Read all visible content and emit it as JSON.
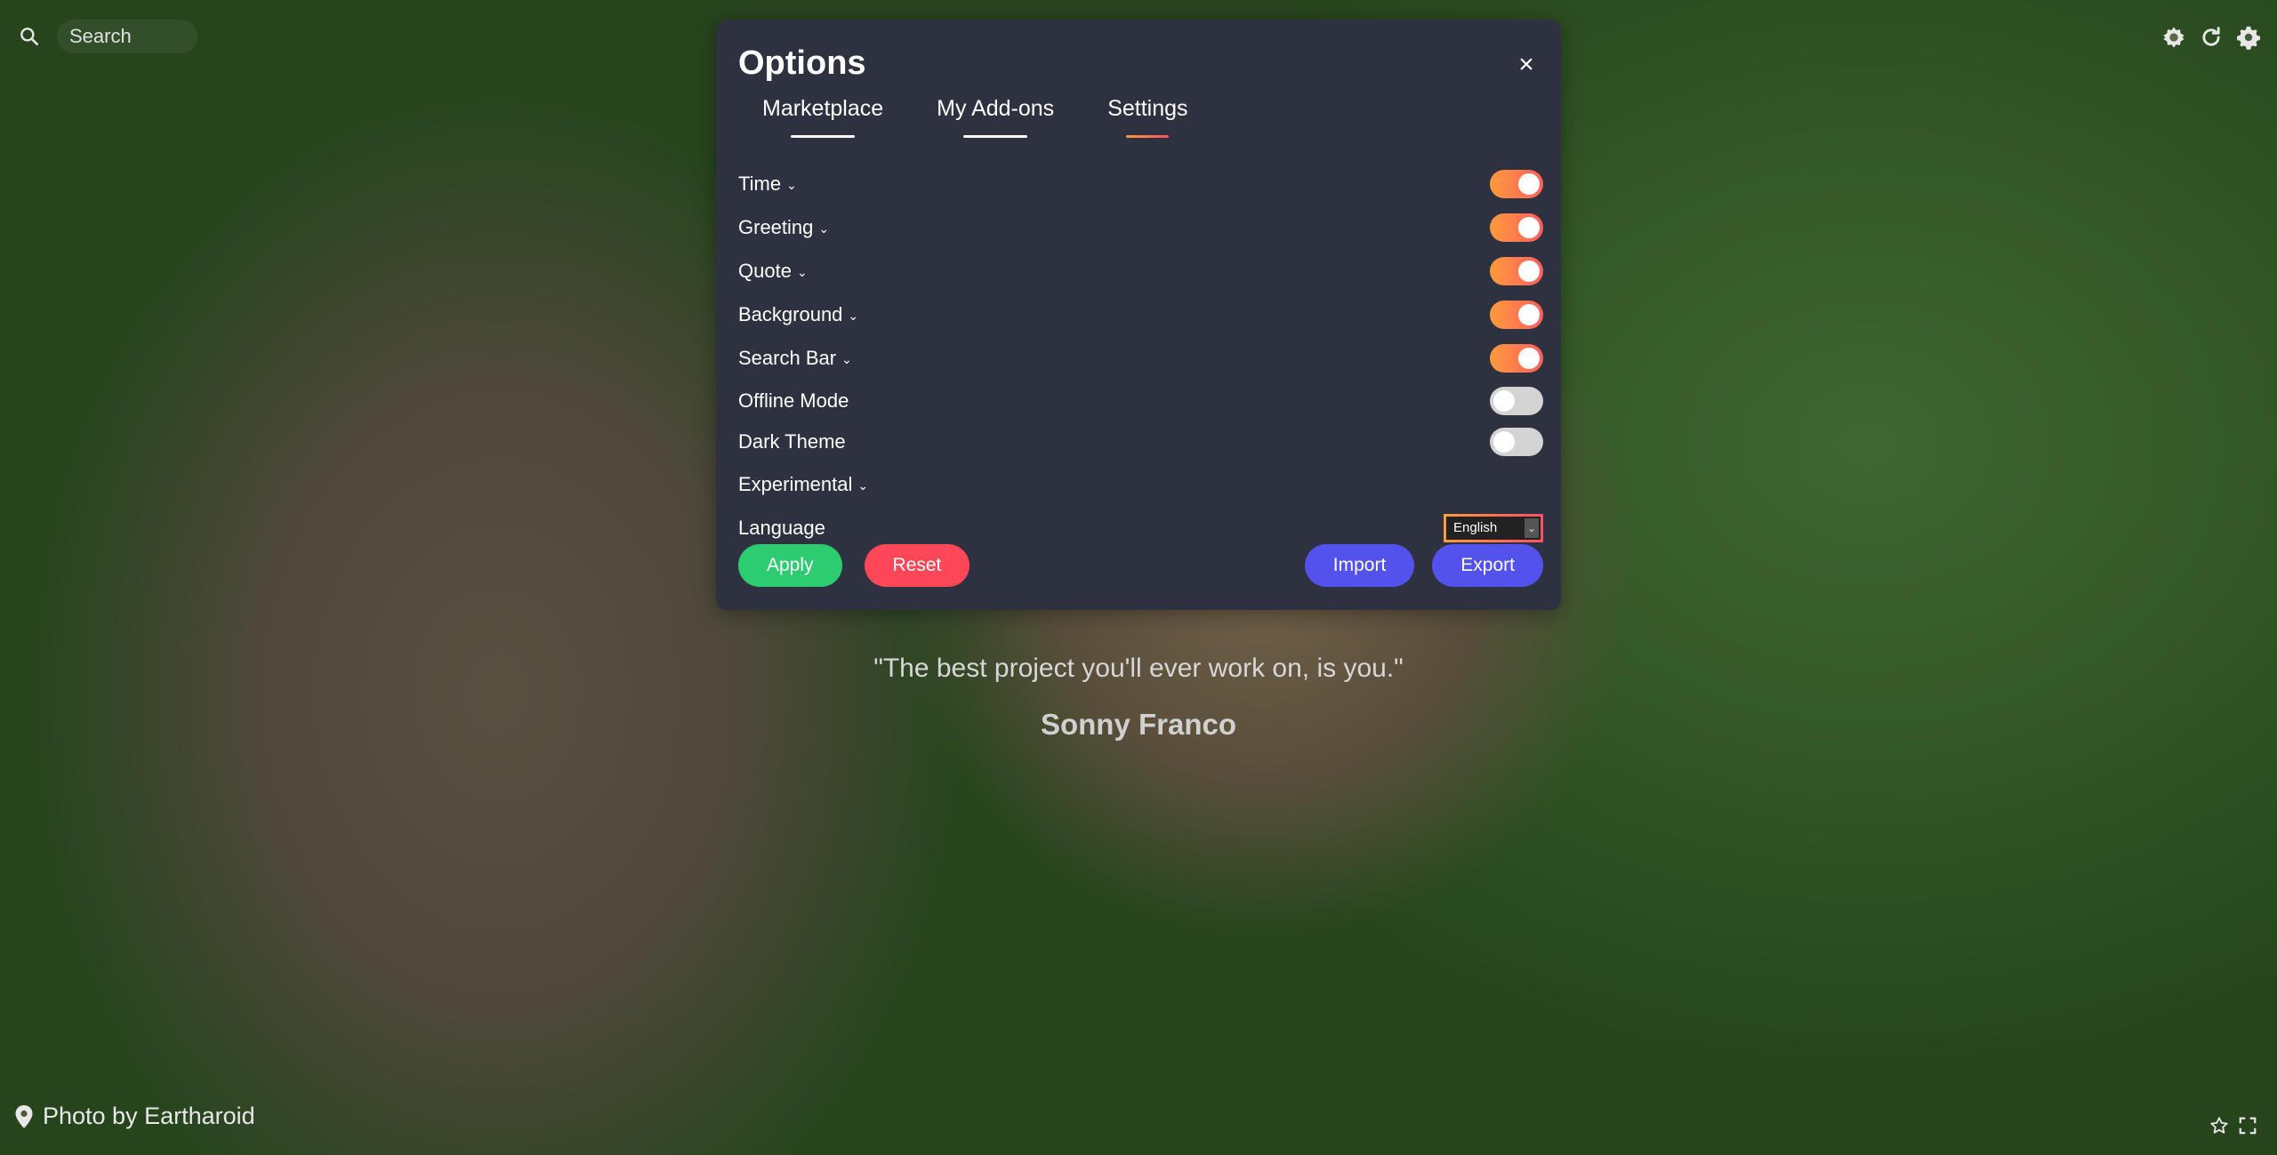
{
  "search": {
    "placeholder": "Search"
  },
  "options": {
    "title": "Options",
    "close_label": "×",
    "tabs": [
      {
        "label": "Marketplace",
        "active": false
      },
      {
        "label": "My Add-ons",
        "active": false
      },
      {
        "label": "Settings",
        "active": true
      }
    ],
    "rows": [
      {
        "label": "Time",
        "expandable": true,
        "toggle": "on"
      },
      {
        "label": "Greeting",
        "expandable": true,
        "toggle": "on"
      },
      {
        "label": "Quote",
        "expandable": true,
        "toggle": "on"
      },
      {
        "label": "Background",
        "expandable": true,
        "toggle": "on"
      },
      {
        "label": "Search Bar",
        "expandable": true,
        "toggle": "on"
      },
      {
        "label": "Offline Mode",
        "expandable": false,
        "toggle": "off"
      },
      {
        "label": "Dark Theme",
        "expandable": false,
        "toggle": "off"
      },
      {
        "label": "Experimental",
        "expandable": true,
        "toggle": null
      }
    ],
    "language": {
      "label": "Language",
      "selected": "English"
    },
    "buttons": {
      "apply": "Apply",
      "reset": "Reset",
      "import": "Import",
      "export": "Export"
    }
  },
  "quote": {
    "text": "\"The best project you'll ever work on, is you.\"",
    "author": "Sonny Franco"
  },
  "photo": {
    "credit": "Photo by Eartharoid"
  },
  "colors": {
    "modal_bg": "#2e3240",
    "toggle_on": "#ff9a3c",
    "toggle_off": "#d4d4d4",
    "apply": "#2ecc71",
    "reset": "#ff4757",
    "import_export": "#5352ed"
  },
  "icons": {
    "search": "search-icon",
    "top_right": [
      "weather-icon",
      "refresh-icon",
      "gear-icon"
    ],
    "location": "location-pin-icon",
    "bottom_right": [
      "star-icon",
      "fullscreen-icon"
    ]
  }
}
